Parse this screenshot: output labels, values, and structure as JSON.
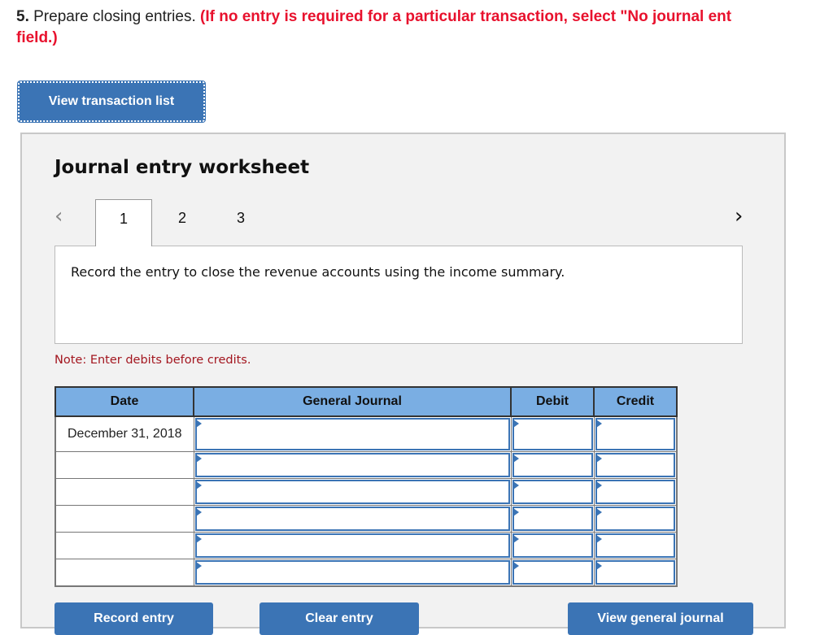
{
  "question": {
    "number": "5.",
    "text": " Prepare closing entries. ",
    "hint": "(If no entry is required for a particular transaction, select \"No journal ent",
    "hint_line2": "field.)"
  },
  "view_transaction_button": "View transaction list",
  "worksheet": {
    "title": "Journal entry worksheet",
    "tabs": [
      "1",
      "2",
      "3"
    ],
    "active_tab": "1",
    "prev_icon": "‹",
    "next_icon": "›",
    "instruction": "Record the entry to close the revenue accounts using the income summary.",
    "note": "Note: Enter debits before credits."
  },
  "journal_table": {
    "headers": {
      "date": "Date",
      "general_journal": "General Journal",
      "debit": "Debit",
      "credit": "Credit"
    },
    "rows": [
      {
        "date": "December 31, 2018",
        "account": "",
        "debit": "",
        "credit": ""
      },
      {
        "date": "",
        "account": "",
        "debit": "",
        "credit": ""
      },
      {
        "date": "",
        "account": "",
        "debit": "",
        "credit": ""
      },
      {
        "date": "",
        "account": "",
        "debit": "",
        "credit": ""
      },
      {
        "date": "",
        "account": "",
        "debit": "",
        "credit": ""
      },
      {
        "date": "",
        "account": "",
        "debit": "",
        "credit": ""
      }
    ]
  },
  "bottom_buttons": [
    "Record entry",
    "Clear entry",
    "View general journal"
  ],
  "colors": {
    "accent_blue": "#3b74b5",
    "header_blue": "#7aaee3",
    "hint_red": "#e8112d",
    "note_red": "#a3161f"
  }
}
